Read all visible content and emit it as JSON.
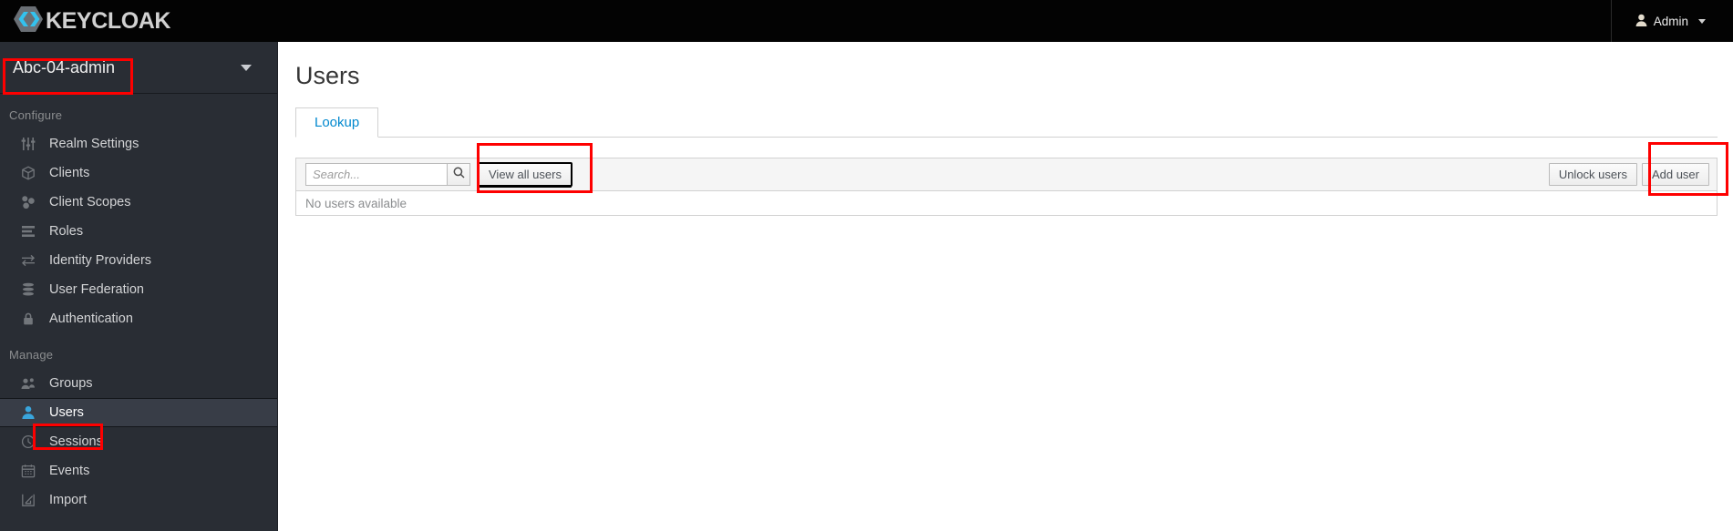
{
  "masthead": {
    "brand": "KEYCLOAK",
    "brand_icon": "keycloak-logo-icon",
    "user_label": "Admin",
    "user_icon": "user-avatar-icon",
    "caret_icon": "chevron-down-icon"
  },
  "sidebar": {
    "realm": {
      "name": "Abc-04-admin",
      "caret_icon": "chevron-down-icon"
    },
    "sections": [
      {
        "title": "Configure",
        "items": [
          {
            "label": "Realm Settings",
            "icon": "sliders-icon",
            "active": false
          },
          {
            "label": "Clients",
            "icon": "cube-icon",
            "active": false
          },
          {
            "label": "Client Scopes",
            "icon": "blocks-icon",
            "active": false
          },
          {
            "label": "Roles",
            "icon": "list-icon",
            "active": false
          },
          {
            "label": "Identity Providers",
            "icon": "exchange-icon",
            "active": false
          },
          {
            "label": "User Federation",
            "icon": "database-icon",
            "active": false
          },
          {
            "label": "Authentication",
            "icon": "lock-icon",
            "active": false
          }
        ]
      },
      {
        "title": "Manage",
        "items": [
          {
            "label": "Groups",
            "icon": "group-icon",
            "active": false
          },
          {
            "label": "Users",
            "icon": "user-icon",
            "active": true
          },
          {
            "label": "Sessions",
            "icon": "clock-icon",
            "active": false
          },
          {
            "label": "Events",
            "icon": "calendar-icon",
            "active": false
          },
          {
            "label": "Import",
            "icon": "import-icon",
            "active": false
          }
        ]
      }
    ]
  },
  "main": {
    "page_title": "Users",
    "tabs": [
      {
        "label": "Lookup",
        "active": true
      }
    ],
    "toolbar": {
      "search_placeholder": "Search...",
      "search_value": "",
      "search_icon": "search-icon",
      "view_all_users_label": "View all users",
      "unlock_users_label": "Unlock users",
      "add_user_label": "Add user"
    },
    "table": {
      "empty_message": "No users available"
    }
  },
  "annotations": {
    "color": "#fe0000",
    "targets": [
      "realm-selector",
      "sidebar-item-users",
      "view-all-users-button",
      "add-user-button"
    ]
  },
  "colors": {
    "masthead_bg": "#030303",
    "sidebar_bg": "#292d34",
    "sidebar_active_bg": "#383d47",
    "accent_blue": "#0088ce",
    "icon_active": "#39a5dc",
    "annotation_red": "#fe0000"
  }
}
